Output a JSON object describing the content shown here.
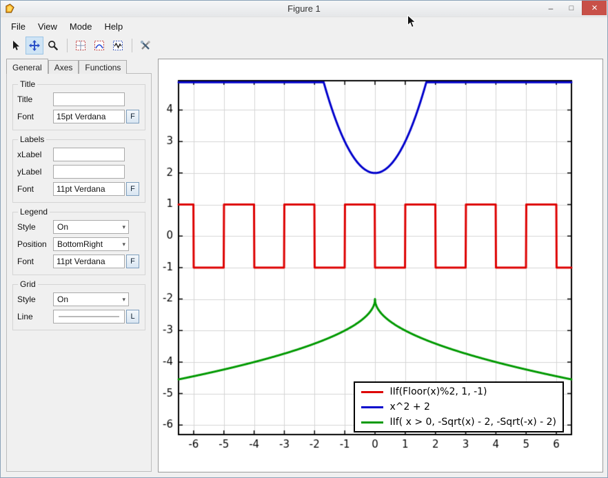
{
  "window": {
    "title": "Figure 1",
    "buttons": {
      "minimize": "–",
      "maximize": "□",
      "close": "×"
    }
  },
  "menu": {
    "items": [
      "File",
      "View",
      "Mode",
      "Help"
    ]
  },
  "toolbar": {
    "tools": [
      "pointer",
      "pan",
      "zoom",
      "subplots-grid",
      "zoom-region",
      "fit-region",
      "tools"
    ],
    "active_tool": "pan"
  },
  "ui": {
    "combo_arrow": "▾"
  },
  "sidebar": {
    "tabs": [
      {
        "label": "General",
        "active": true
      },
      {
        "label": "Axes",
        "active": false
      },
      {
        "label": "Functions",
        "active": false
      }
    ],
    "title_group": {
      "legend": "Title",
      "title_label": "Title",
      "title_value": "",
      "font_label": "Font",
      "font_value": "15pt Verdana",
      "font_button": "F"
    },
    "labels_group": {
      "legend": "Labels",
      "xlabel_label": "xLabel",
      "xlabel_value": "",
      "ylabel_label": "yLabel",
      "ylabel_value": "",
      "font_label": "Font",
      "font_value": "11pt Verdana",
      "font_button": "F"
    },
    "legend_group": {
      "legend": "Legend",
      "style_label": "Style",
      "style_value": "On",
      "position_label": "Position",
      "position_value": "BottomRight",
      "font_label": "Font",
      "font_value": "11pt Verdana",
      "font_button": "F"
    },
    "grid_group": {
      "legend": "Grid",
      "style_label": "Style",
      "style_value": "On",
      "line_label": "Line",
      "line_button": "L"
    }
  },
  "chart_data": {
    "type": "line",
    "title": "",
    "xlabel": "",
    "ylabel": "",
    "x_range": [
      -6.5,
      6.5
    ],
    "y_range": [
      -6.3,
      4.93
    ],
    "x_ticks": [
      -6,
      -5,
      -4,
      -3,
      -2,
      -1,
      0,
      1,
      2,
      3,
      4,
      5,
      6
    ],
    "y_ticks": [
      4,
      3,
      2,
      1,
      0,
      -1,
      -2,
      -3,
      -4,
      -5,
      -6
    ],
    "grid": "on",
    "grid_color": "#d4d4d4",
    "legend_style": "On",
    "legend_position": "BottomRight",
    "series": [
      {
        "name": "IIf(Floor(x)%2, 1, -1)",
        "color": "#dd0000",
        "fn": "square",
        "description": "square wave, period 2, values +1/-1"
      },
      {
        "name": "x^2 + 2",
        "color": "#0000cc",
        "fn": "parabola",
        "description": "parabola with vertex (0,2), clipped at top of view"
      },
      {
        "name": "IIf( x > 0, -Sqrt(x) - 2, -Sqrt(-x) - 2)",
        "color": "#009900",
        "fn": "negsqrt",
        "description": "-sqrt(|x|)-2, peak (0,-2), ends near (±6.5,-4.55)"
      }
    ]
  }
}
